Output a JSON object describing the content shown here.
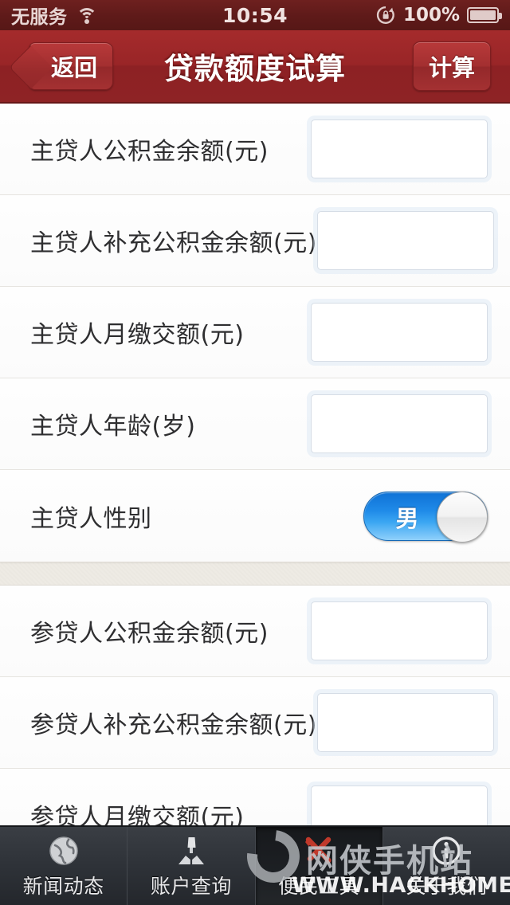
{
  "status_bar": {
    "carrier": "无服务",
    "wifi_icon": "wifi-icon",
    "time": "10:54",
    "rotation_lock_icon": "rotation-lock-icon",
    "battery_percent": "100%",
    "battery_icon": "battery-full-icon"
  },
  "nav_bar": {
    "back_label": "返回",
    "title": "贷款额度试算",
    "action_label": "计算"
  },
  "form": {
    "sections": [
      {
        "name": "primary-borrower",
        "rows": [
          {
            "label": "主贷人公积金余额(元)",
            "type": "input",
            "value": "",
            "placeholder": ""
          },
          {
            "label": "主贷人补充公积金余额(元)",
            "type": "input",
            "value": "",
            "placeholder": ""
          },
          {
            "label": "主贷人月缴交额(元)",
            "type": "input",
            "value": "",
            "placeholder": ""
          },
          {
            "label": "主贷人年龄(岁)",
            "type": "input",
            "value": "",
            "placeholder": ""
          },
          {
            "label": "主贷人性别",
            "type": "switch",
            "value": "男",
            "state": "on"
          }
        ]
      },
      {
        "name": "co-borrower",
        "rows": [
          {
            "label": "参贷人公积金余额(元)",
            "type": "input",
            "value": "",
            "placeholder": ""
          },
          {
            "label": "参贷人补充公积金余额(元)",
            "type": "input",
            "value": "",
            "placeholder": ""
          },
          {
            "label": "参贷人月缴交额(元)",
            "type": "input",
            "value": "",
            "placeholder": ""
          }
        ]
      }
    ]
  },
  "tab_bar": {
    "tabs": [
      {
        "label": "新闻动态",
        "icon": "globe-icon",
        "active": false
      },
      {
        "label": "账户查询",
        "icon": "person-document-icon",
        "active": false
      },
      {
        "label": "便民工具",
        "icon": "tools-icon",
        "active": true
      },
      {
        "label": "关于我们",
        "icon": "info-circle-icon",
        "active": false
      }
    ]
  },
  "watermark": {
    "title": "网侠手机站",
    "url": "WWW.HACKHOME.COM"
  },
  "colors": {
    "nav_red": "#992527",
    "status_red": "#5e1a19",
    "switch_blue": "#1f8ae8",
    "tab_dark": "#2e3238",
    "tools_red": "#c0392b"
  }
}
